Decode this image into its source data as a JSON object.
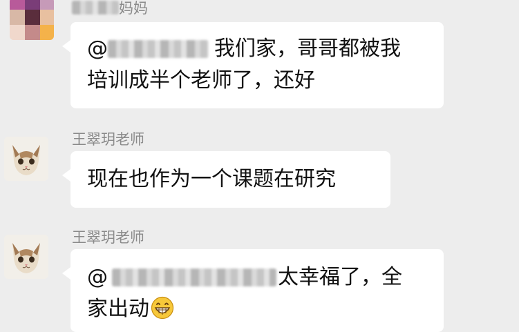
{
  "messages": [
    {
      "sender": "妈妈",
      "sender_blurred": true,
      "line1_prefix": "@",
      "line1_text": "我们家，哥哥都被我",
      "line2_text": "培训成半个老师了，还好"
    },
    {
      "sender": "王翠玥老师",
      "text": "现在也作为一个课题在研究"
    },
    {
      "sender": "王翠玥老师",
      "line1_prefix": "@",
      "line1_text": "太幸福了，全",
      "line2_text": "家出动",
      "emoji": "grinning-face-emoji"
    }
  ],
  "colors": {
    "background": "#ededed",
    "bubble": "#ffffff",
    "sender_text": "#8a8a8a",
    "message_text": "#111111"
  }
}
